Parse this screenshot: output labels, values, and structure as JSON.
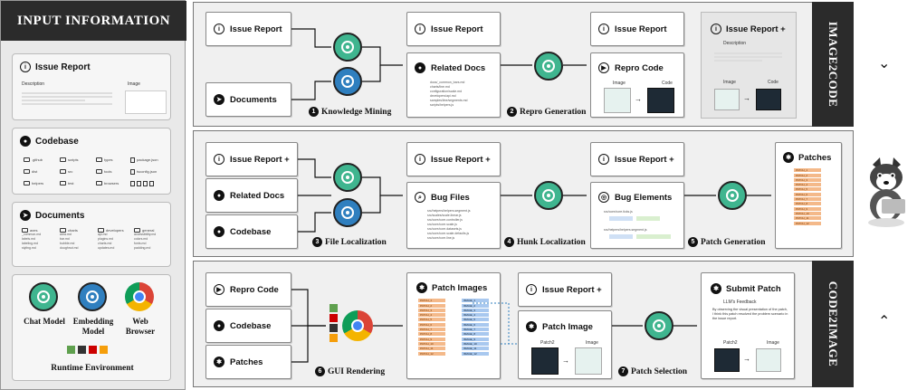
{
  "left_panel": {
    "header": "INPUT INFORMATION",
    "issue_report": {
      "title": "Issue Report",
      "description_label": "Description",
      "image_label": "Image"
    },
    "codebase": {
      "title": "Codebase",
      "items": [
        ".github",
        "scripts",
        "types",
        "package.json",
        "dist",
        "src",
        "tools",
        "tsconfig.json",
        "helpers",
        "test",
        "browsers"
      ]
    },
    "documents": {
      "title": "Documents",
      "columns": [
        {
          "name": "axes",
          "files": [
            "_common.md",
            "labels.md",
            "labeling.md",
            "styling.md"
          ]
        },
        {
          "name": "charts",
          "files": [
            "area.md",
            "bar.md",
            "bubble.md",
            "doughnut.md"
          ]
        },
        {
          "name": "developers",
          "files": [
            "api.md",
            "plugins.md",
            "charts.md",
            "updates.md"
          ]
        },
        {
          "name": "general",
          "files": [
            "accessibility.md",
            "colors.md",
            "fonts.md",
            "padding.md"
          ]
        }
      ]
    },
    "runtime": {
      "tools": [
        "Chat Model",
        "Embedding Model",
        "Web Browser"
      ],
      "title": "Runtime Environment"
    }
  },
  "rows": {
    "image2code_label": "IMAGE2CODE",
    "code2image_label": "CODE2IMAGE"
  },
  "row1": {
    "issue_report": "Issue Report",
    "documents": "Documents",
    "step1": "Knowledge Mining",
    "issue_report_2": "Issue Report",
    "related_docs": "Related Docs",
    "related_docs_files": [
      "docs/_common_bars.md",
      "charts/line.md",
      "configuration/scale.md",
      "developers/api.md",
      "samples/line/segments.md",
      "scripts/helpers.js"
    ],
    "step2": "Repro Generation",
    "issue_report_3": "Issue Report",
    "repro_code": "Repro Code",
    "image_label": "Image",
    "code_label": "Code",
    "issue_report_plus": "Issue Report +",
    "description_label": "Description",
    "image_label_2": "Image",
    "code_label_2": "Code"
  },
  "row2": {
    "issue_report_plus": "Issue Report +",
    "related_docs": "Related Docs",
    "codebase": "Codebase",
    "step3": "File Localization",
    "issue_report_plus_2": "Issue Report +",
    "bug_files": "Bug Files",
    "bug_files_list": [
      "src/helpers/helpers.segment.js",
      "src/scales/scale.linear.js",
      "src/core/core.controller.js",
      "src/core/core.scale.js",
      "src/core/core.datasets.js",
      "src/core/core.scale.defaults.js",
      "src/core/core.line.js"
    ],
    "step4": "Hunk Localization",
    "issue_report_plus_3": "Issue Report +",
    "bug_elements": "Bug Elements",
    "bug_element_files": [
      "src/core/core.ticks.js",
      "src/helpers/helpers.segment.js"
    ],
    "step5": "Patch Generation",
    "patches": "Patches",
    "patch_items": [
      "PATCH_1",
      "PATCH_2",
      "PATCH_3",
      "PATCH_4",
      "PATCH_5",
      "PATCH_6",
      "PATCH_7",
      "PATCH_8",
      "PATCH_9",
      "PATCH_10",
      "PATCH_11",
      "PATCH_12"
    ]
  },
  "row3": {
    "repro_code": "Repro Code",
    "codebase": "Codebase",
    "patches": "Patches",
    "step6": "GUI Rendering",
    "patch_images": "Patch Images",
    "patch_image_rows": [
      "PATCH_1",
      "PATCH_2",
      "PATCH_3",
      "PATCH_4",
      "PATCH_5",
      "PATCH_6",
      "PATCH_7",
      "PATCH_8",
      "PATCH_9",
      "PATCH_10",
      "PATCH_11",
      "PATCH_12"
    ],
    "image_rows": [
      "IMAGE_1",
      "IMAGE_2",
      "IMAGE_3",
      "IMAGE_4",
      "IMAGE_5",
      "IMAGE_6",
      "IMAGE_7",
      "IMAGE_8",
      "IMAGE_9",
      "IMAGE_10",
      "IMAGE_11",
      "IMAGE_12"
    ],
    "issue_report_plus": "Issue Report +",
    "patch_image": "Patch Image",
    "patch2_label": "Patch2",
    "image_label": "Image",
    "step7": "Patch Selection",
    "submit_patch": "Submit Patch",
    "feedback_title": "LLM's Feedback",
    "feedback_text": "By observing the visual presentation of the patch, I think this patch resolved the problem scenario in the issue report.",
    "patch2_label_2": "Patch2",
    "image_label_2": "Image"
  },
  "colors": {
    "dark": "#2b2b2b",
    "chat_model": "#3fb58f",
    "embedding_model": "#2f7fbf",
    "patch": "#f4b98a",
    "image": "#a8c8ef"
  },
  "icons": [
    "info-icon",
    "github-icon",
    "rocket-icon",
    "chatgpt-icon",
    "chrome-icon",
    "play-icon",
    "target-icon",
    "search-icon",
    "patches-icon",
    "submit-icon",
    "dog-mascot"
  ]
}
